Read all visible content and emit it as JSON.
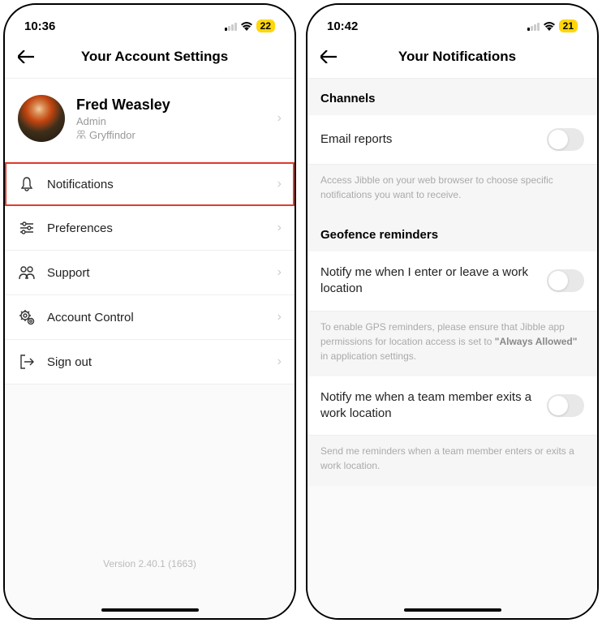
{
  "left": {
    "statusbar": {
      "time": "10:36",
      "battery": "22"
    },
    "header": {
      "title": "Your Account Settings"
    },
    "profile": {
      "name": "Fred Weasley",
      "role": "Admin",
      "group": "Gryffindor"
    },
    "menu": {
      "notifications": "Notifications",
      "preferences": "Preferences",
      "support": "Support",
      "account_control": "Account Control",
      "sign_out": "Sign out"
    },
    "version": "Version 2.40.1 (1663)"
  },
  "right": {
    "statusbar": {
      "time": "10:42",
      "battery": "21"
    },
    "header": {
      "title": "Your Notifications"
    },
    "sections": {
      "channels": {
        "title": "Channels",
        "email_reports": "Email reports",
        "help": "Access Jibble on your web browser to choose specific notifications you want to receive."
      },
      "geofence": {
        "title": "Geofence reminders",
        "notify_self": "Notify me when I enter or leave a work location",
        "help_self_prefix": "To enable GPS reminders, please ensure that Jibble app permissions for location access is set to ",
        "help_self_bold": "\"Always Allowed\"",
        "help_self_suffix": " in application settings.",
        "notify_team": "Notify me when a team member exits a work location",
        "help_team": "Send me reminders when a team member enters or exits a work location."
      }
    }
  }
}
